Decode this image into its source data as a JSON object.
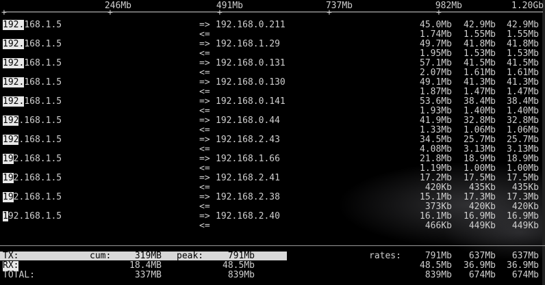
{
  "scale": {
    "ticks": [
      "246Mb",
      "491Mb",
      "737Mb",
      "982Mb",
      "1.20Gb"
    ]
  },
  "hosts": [
    {
      "src": "192.168.1.5",
      "src_hl": "192.",
      "src_rest": "168.1.5",
      "dst": "192.168.0.211",
      "tx": [
        "45.0Mb",
        "42.9Mb",
        "42.9Mb"
      ],
      "rx": [
        "1.74Mb",
        "1.55Mb",
        "1.55Mb"
      ]
    },
    {
      "src": "192.168.1.5",
      "src_hl": "192.",
      "src_rest": "168.1.5",
      "dst": "192.168.1.29",
      "tx": [
        "49.7Mb",
        "41.8Mb",
        "41.8Mb"
      ],
      "rx": [
        "1.95Mb",
        "1.53Mb",
        "1.53Mb"
      ]
    },
    {
      "src": "192.168.1.5",
      "src_hl": "192.",
      "src_rest": "168.1.5",
      "dst": "192.168.0.131",
      "tx": [
        "57.1Mb",
        "41.5Mb",
        "41.5Mb"
      ],
      "rx": [
        "2.07Mb",
        "1.61Mb",
        "1.61Mb"
      ]
    },
    {
      "src": "192.168.1.5",
      "src_hl": "192.",
      "src_rest": "168.1.5",
      "dst": "192.168.0.130",
      "tx": [
        "49.1Mb",
        "41.3Mb",
        "41.3Mb"
      ],
      "rx": [
        "1.87Mb",
        "1.47Mb",
        "1.47Mb"
      ]
    },
    {
      "src": "192.168.1.5",
      "src_hl": "192.",
      "src_rest": "168.1.5",
      "dst": "192.168.0.141",
      "tx": [
        "53.6Mb",
        "38.4Mb",
        "38.4Mb"
      ],
      "rx": [
        "1.93Mb",
        "1.40Mb",
        "1.40Mb"
      ]
    },
    {
      "src": "192.168.1.5",
      "src_hl": "192",
      "src_rest": ".168.1.5",
      "dst": "192.168.0.44",
      "tx": [
        "41.9Mb",
        "32.8Mb",
        "32.8Mb"
      ],
      "rx": [
        "1.33Mb",
        "1.06Mb",
        "1.06Mb"
      ]
    },
    {
      "src": "192.168.1.5",
      "src_hl": "192",
      "src_rest": ".168.1.5",
      "dst": "192.168.2.43",
      "tx": [
        "34.5Mb",
        "25.7Mb",
        "25.7Mb"
      ],
      "rx": [
        "4.08Mb",
        "3.13Mb",
        "3.13Mb"
      ]
    },
    {
      "src": "192.168.1.5",
      "src_hl": "19",
      "src_rest": "2.168.1.5",
      "dst": "192.168.1.66",
      "tx": [
        "21.8Mb",
        "18.9Mb",
        "18.9Mb"
      ],
      "rx": [
        "1.19Mb",
        "1.00Mb",
        "1.00Mb"
      ]
    },
    {
      "src": "192.168.1.5",
      "src_hl": "19",
      "src_rest": "2.168.1.5",
      "dst": "192.168.2.41",
      "tx": [
        "17.2Mb",
        "17.5Mb",
        "17.5Mb"
      ],
      "rx": [
        "420Kb",
        "435Kb",
        "435Kb"
      ]
    },
    {
      "src": "192.168.1.5",
      "src_hl": "19",
      "src_rest": "2.168.1.5",
      "dst": "192.168.2.38",
      "tx": [
        "15.1Mb",
        "17.3Mb",
        "17.3Mb"
      ],
      "rx": [
        "373Kb",
        "420Kb",
        "420Kb"
      ]
    },
    {
      "src": "192.168.1.5",
      "src_hl": "1",
      "src_rest": "92.168.1.5",
      "dst": "192.168.2.40",
      "tx": [
        "16.1Mb",
        "16.9Mb",
        "16.9Mb"
      ],
      "rx": [
        "466Kb",
        "449Kb",
        "449Kb"
      ]
    }
  ],
  "arrows": {
    "out": "=>",
    "in": "<="
  },
  "footer": {
    "tx_label": "TX:",
    "cum_label": "cum:",
    "peak_label": "peak:",
    "rates_label": "rates:",
    "rx_label": "RX:",
    "total_label": "TOTAL:",
    "tx_cum": "319MB",
    "tx_peak": "791Mb",
    "tx_rates": [
      "791Mb",
      "637Mb",
      "637Mb"
    ],
    "rx_cum": "18.4MB",
    "rx_peak": "48.5Mb",
    "rx_rates": [
      "48.5Mb",
      "36.9Mb",
      "36.9Mb"
    ],
    "total_cum": "337MB",
    "total_peak": "839Mb",
    "total_rates": [
      "839Mb",
      "674Mb",
      "674Mb"
    ]
  }
}
